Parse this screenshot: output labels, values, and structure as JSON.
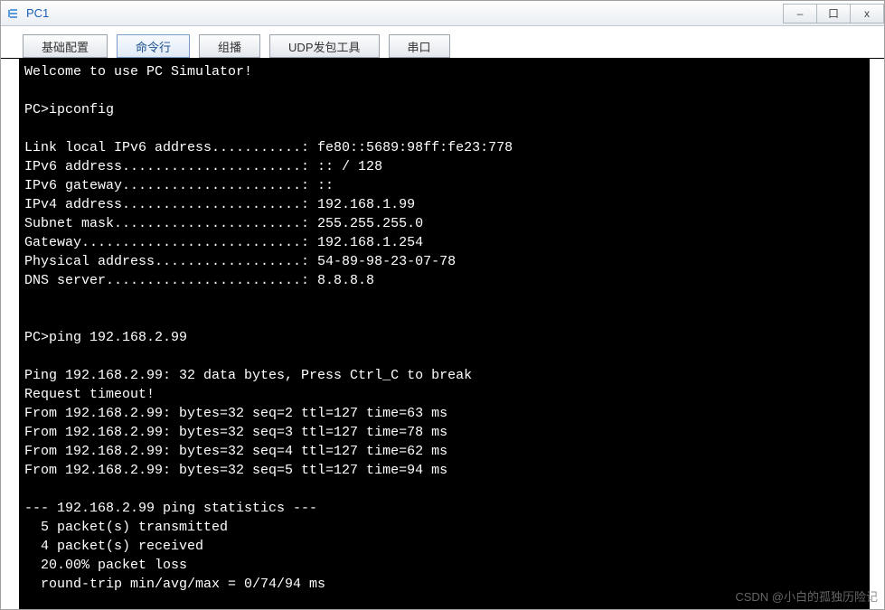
{
  "window": {
    "title": "PC1",
    "controls": {
      "minimize": "–",
      "maximize": "口",
      "close": "x"
    }
  },
  "tabs": [
    {
      "label": "基础配置"
    },
    {
      "label": "命令行"
    },
    {
      "label": "组播"
    },
    {
      "label": "UDP发包工具"
    },
    {
      "label": "串口"
    }
  ],
  "terminal": {
    "welcome": "Welcome to use PC Simulator!",
    "prompt1": "PC>ipconfig",
    "blank": "",
    "ipconfig": {
      "linklocal": "Link local IPv6 address...........: fe80::5689:98ff:fe23:778",
      "ipv6addr": "IPv6 address......................: :: / 128",
      "ipv6gw": "IPv6 gateway......................: ::",
      "ipv4addr": "IPv4 address......................: 192.168.1.99",
      "subnet": "Subnet mask.......................: 255.255.255.0",
      "gateway": "Gateway...........................: 192.168.1.254",
      "mac": "Physical address..................: 54-89-98-23-07-78",
      "dns": "DNS server........................: 8.8.8.8"
    },
    "prompt2": "PC>ping 192.168.2.99",
    "ping": {
      "header": "Ping 192.168.2.99: 32 data bytes, Press Ctrl_C to break",
      "timeout": "Request timeout!",
      "r1": "From 192.168.2.99: bytes=32 seq=2 ttl=127 time=63 ms",
      "r2": "From 192.168.2.99: bytes=32 seq=3 ttl=127 time=78 ms",
      "r3": "From 192.168.2.99: bytes=32 seq=4 ttl=127 time=62 ms",
      "r4": "From 192.168.2.99: bytes=32 seq=5 ttl=127 time=94 ms"
    },
    "stats": {
      "header": "--- 192.168.2.99 ping statistics ---",
      "tx": "  5 packet(s) transmitted",
      "rx": "  4 packet(s) received",
      "loss": "  20.00% packet loss",
      "rtt": "  round-trip min/avg/max = 0/74/94 ms"
    }
  },
  "watermark": "CSDN @小白的孤独历险记"
}
